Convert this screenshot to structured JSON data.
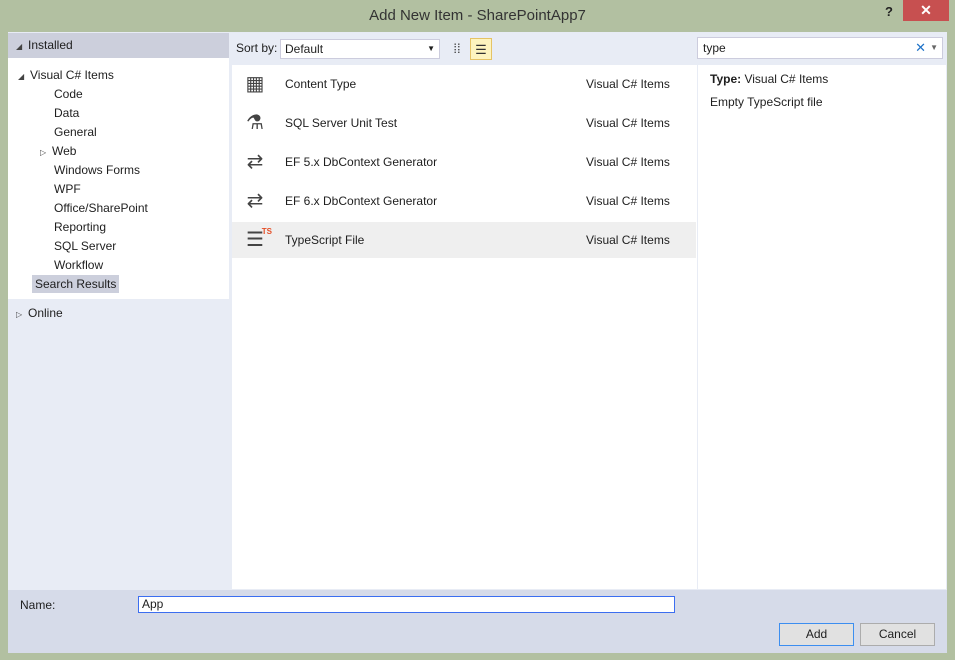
{
  "window": {
    "title": "Add New Item - SharePointApp7",
    "help": "?",
    "close": "✕"
  },
  "left": {
    "installed": "Installed",
    "root": "Visual C# Items",
    "children": [
      "Code",
      "Data",
      "General",
      "Web",
      "Windows Forms",
      "WPF",
      "Office/SharePoint",
      "Reporting",
      "SQL Server",
      "Workflow"
    ],
    "search_results": "Search Results",
    "online": "Online"
  },
  "toolbar": {
    "sort_label": "Sort by:",
    "sort_value": "Default"
  },
  "search": {
    "value": "type"
  },
  "items": [
    {
      "name": "Content Type",
      "category": "Visual C# Items",
      "icon": "content-type-icon"
    },
    {
      "name": "SQL Server Unit Test",
      "category": "Visual C# Items",
      "icon": "sql-test-icon"
    },
    {
      "name": "EF 5.x DbContext Generator",
      "category": "Visual C# Items",
      "icon": "ef-generator-icon"
    },
    {
      "name": "EF 6.x DbContext Generator",
      "category": "Visual C# Items",
      "icon": "ef-generator-icon"
    },
    {
      "name": "TypeScript File",
      "category": "Visual C# Items",
      "icon": "typescript-file-icon"
    }
  ],
  "details": {
    "type_label": "Type:",
    "type_value": "Visual C# Items",
    "description": "Empty TypeScript file"
  },
  "bottom": {
    "name_label": "Name:",
    "name_value": "App",
    "add": "Add",
    "cancel": "Cancel"
  }
}
